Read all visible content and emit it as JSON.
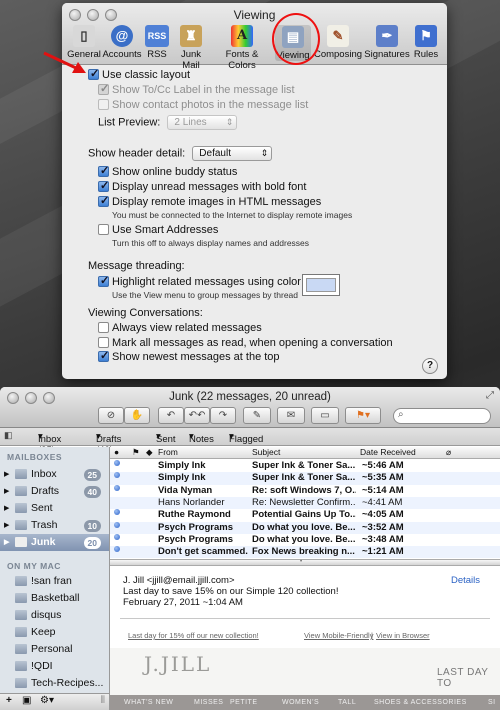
{
  "prefs": {
    "title": "Viewing",
    "tabs": [
      {
        "label": "General",
        "icon": "switch-icon"
      },
      {
        "label": "Accounts",
        "icon": "at-sign-icon"
      },
      {
        "label": "RSS",
        "icon": "rss-icon"
      },
      {
        "label": "Junk Mail",
        "icon": "junk-bag-icon"
      },
      {
        "label": "Fonts & Colors",
        "icon": "fonts-colors-icon"
      },
      {
        "label": "Viewing",
        "icon": "viewing-icon"
      },
      {
        "label": "Composing",
        "icon": "composing-pencil-icon"
      },
      {
        "label": "Signatures",
        "icon": "signature-pen-icon"
      },
      {
        "label": "Rules",
        "icon": "rules-icon"
      }
    ],
    "active_tab": "Viewing",
    "use_classic_layout": "Use classic layout",
    "show_tocc": "Show To/Cc Label in the message list",
    "show_photos": "Show contact photos in the message list",
    "list_preview_label": "List Preview:",
    "list_preview_value": "2 Lines",
    "header_detail_label": "Show header detail:",
    "header_detail_value": "Default",
    "buddy_status": "Show online buddy status",
    "unread_bold": "Display unread messages with bold font",
    "remote_images": "Display remote images in HTML messages",
    "remote_images_note": "You must be connected to the Internet to display remote images",
    "smart_addresses": "Use Smart Addresses",
    "smart_addresses_note": "Turn this off to always display names and addresses",
    "threading_heading": "Message threading:",
    "highlight_related": "Highlight related messages using color",
    "highlight_note": "Use the View menu to group messages by thread",
    "conversations_heading": "Viewing Conversations:",
    "always_view_related": "Always view related messages",
    "mark_all_read": "Mark all messages as read, when opening a conversation",
    "show_newest_top": "Show newest messages at the top",
    "help": "?",
    "accent": "#e11111"
  },
  "mail": {
    "title": "Junk (22 messages, 20 unread)",
    "favorites": [
      "Inbox (25)",
      "Drafts (40)",
      "Sent",
      "Notes",
      "Flagged"
    ],
    "mailboxes_heading": "MAILBOXES",
    "mailboxes": [
      {
        "label": "Inbox",
        "count": "25"
      },
      {
        "label": "Drafts",
        "count": "40"
      },
      {
        "label": "Sent",
        "count": ""
      },
      {
        "label": "Trash",
        "count": "10"
      },
      {
        "label": "Junk",
        "count": "20"
      }
    ],
    "on_my_mac_heading": "ON MY MAC",
    "local_folders": [
      "!san fran",
      "Basketball",
      "disqus",
      "Keep",
      "Personal",
      "!QDI",
      "Tech-Recipes..."
    ],
    "columns": {
      "from": "From",
      "subject": "Subject",
      "date": "Date Received"
    },
    "messages": [
      {
        "unread": true,
        "from": "Simply Ink",
        "subject": "Super Ink & Toner Sa...",
        "date": "~5:46 AM"
      },
      {
        "unread": true,
        "from": "Simply Ink",
        "subject": "Super Ink & Toner Sa...",
        "date": "~5:35 AM"
      },
      {
        "unread": true,
        "from": "Vida Nyman",
        "subject": "Re: soft Windows 7, O...",
        "date": "~5:14 AM"
      },
      {
        "unread": false,
        "from": "Hans Norlander",
        "subject": "Re: Newsletter Confirm...",
        "date": "~4:41 AM"
      },
      {
        "unread": true,
        "from": "Ruthe Raymond",
        "subject": "Potential Gains Up To...",
        "date": "~4:05 AM"
      },
      {
        "unread": true,
        "from": "Psych Programs",
        "subject": "Do what you love.  Be...",
        "date": "~3:52 AM"
      },
      {
        "unread": true,
        "from": "Psych Programs",
        "subject": "Do what you love.  Be...",
        "date": "~3:48 AM"
      },
      {
        "unread": true,
        "from": "Don't get scammed.",
        "subject": "Fox News breaking n...",
        "date": "~1:21 AM"
      }
    ],
    "preview": {
      "sender": "J. Jill <jjill@email.jjill.com>",
      "subject": "Last day to save 15% on our Simple 120 collection!",
      "date": "February 27, 2011 ~1:04 AM",
      "details": "Details",
      "link_left": "Last day for 15% off our new collection!",
      "link_mid": "View Mobile-Friendly",
      "link_sep": "|",
      "link_right": "View in Browser",
      "brand": "J.JILL",
      "banner": "LAST DAY TO",
      "nav": [
        "WHAT'S NEW",
        "MISSES",
        "PETITE",
        "WOMEN'S",
        "TALL",
        "SHOES & ACCESSORIES",
        "SI"
      ]
    }
  }
}
